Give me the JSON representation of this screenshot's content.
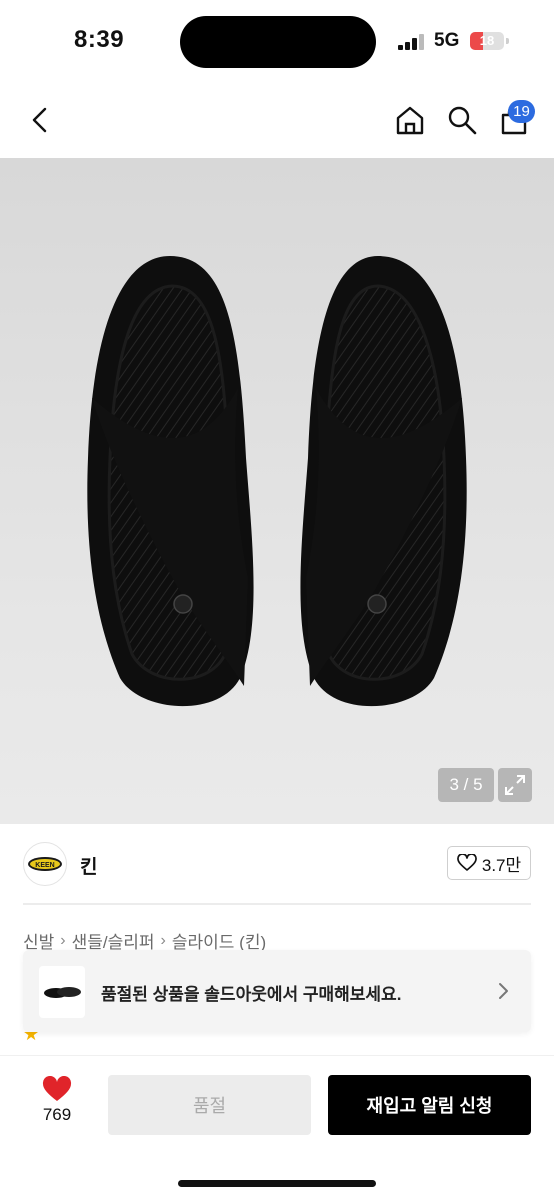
{
  "status_bar": {
    "time": "8:39",
    "network": "5G",
    "battery": "18",
    "battery_level": 0.18
  },
  "nav": {
    "cart_count": "19",
    "icons": [
      "chevron-left-icon",
      "home-icon",
      "search-icon",
      "cart-icon"
    ]
  },
  "gallery": {
    "counter": "3 / 5"
  },
  "brand": {
    "name": "킨",
    "logo_text": "KEEN",
    "likes": "3.7만"
  },
  "breadcrumb": {
    "items": [
      "신발",
      "샌들/슬리퍼",
      "슬라이드 (킨)"
    ]
  },
  "soldout_banner": {
    "text": "품절된 상품을 솔드아웃에서 구매해보세요."
  },
  "bottom": {
    "favorites": "769",
    "soldout_label": "품절",
    "restock_label": "재입고 알림 신청"
  },
  "colors": {
    "accent_blue": "#2c6be0",
    "heart_red": "#e0242a",
    "primary_black": "#000000"
  }
}
